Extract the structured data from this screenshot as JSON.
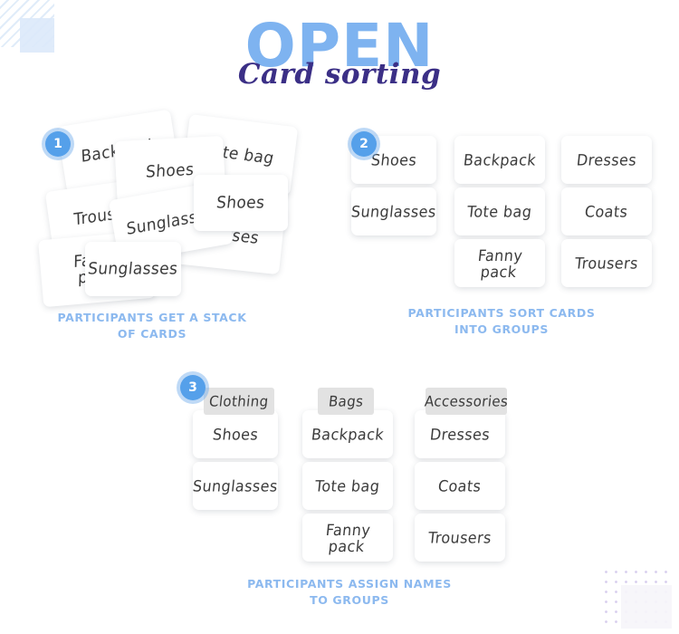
{
  "header": {
    "title": "OPEN",
    "subtitle": "Card sorting"
  },
  "steps": [
    {
      "number": "1",
      "caption_line1": "PARTICIPANTS GET A STACK",
      "caption_line2": "OF CARDS",
      "cards": [
        "Backpack",
        "Trousers",
        "Fanny\npack",
        "Shoes",
        "Sunglasses",
        "Sunglasses",
        "Tote bag",
        "Shoes",
        "Dresses"
      ]
    },
    {
      "number": "2",
      "caption_line1": "PARTICIPANTS SORT CARDS",
      "caption_line2": "INTO GROUPS",
      "columns": [
        {
          "cards": [
            "Shoes",
            "Sunglasses"
          ]
        },
        {
          "cards": [
            "Backpack",
            "Tote bag",
            "Fanny\npack"
          ]
        },
        {
          "cards": [
            "Dresses",
            "Coats",
            "Trousers"
          ]
        }
      ]
    },
    {
      "number": "3",
      "caption_line1": "PARTICIPANTS ASSIGN NAMES",
      "caption_line2": "TO GROUPS",
      "columns": [
        {
          "label": "Clothing",
          "cards": [
            "Shoes",
            "Sunglasses"
          ]
        },
        {
          "label": "Bags",
          "cards": [
            "Backpack",
            "Tote bag",
            "Fanny\npack"
          ]
        },
        {
          "label": "Accessories",
          "cards": [
            "Dresses",
            "Coats",
            "Trousers"
          ]
        }
      ]
    }
  ],
  "colors": {
    "title_blue": "#7eb3f0",
    "subtitle_purple": "#3b2f86",
    "caption_blue": "#8cb9ef",
    "badge_blue": "#55a0ea",
    "card_white": "#ffffff",
    "group_label_gray": "#e2e2e2",
    "deco_blue": "#dce9fa",
    "deco_purple": "#cfc3ea"
  }
}
